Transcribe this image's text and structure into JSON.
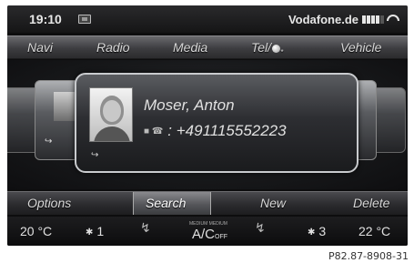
{
  "status_bar": {
    "time": "19:10",
    "carrier": "Vodafone.de",
    "icons": [
      "sim-card-icon",
      "signal-strength-icon",
      "phone-handset-icon"
    ]
  },
  "main_menu": {
    "items": [
      "Navi",
      "Radio",
      "Media",
      "Tel/",
      "Vehicle"
    ],
    "tel_suffix": "*"
  },
  "contact": {
    "name": "Moser, Anton",
    "number": ": +491115552223",
    "icons": [
      "contact-photo",
      "phone-type-icon",
      "bluetooth-icon"
    ]
  },
  "sub_menu": {
    "items": [
      "Options",
      "Search",
      "New",
      "Delete"
    ],
    "selected": "Search"
  },
  "climate": {
    "left_temp": "20 °C",
    "left_fan": "1",
    "ac_top": "MEDIUM MEDIUM",
    "ac_label": "A/C",
    "ac_suffix": "OFF",
    "right_fan": "3",
    "right_temp": "22 °C"
  },
  "footer_code": "P82.87-8908-31",
  "colors": {
    "screen_bg": "#0d0d0e",
    "text": "#e0e0e0",
    "card_border": "#c9cbce"
  }
}
